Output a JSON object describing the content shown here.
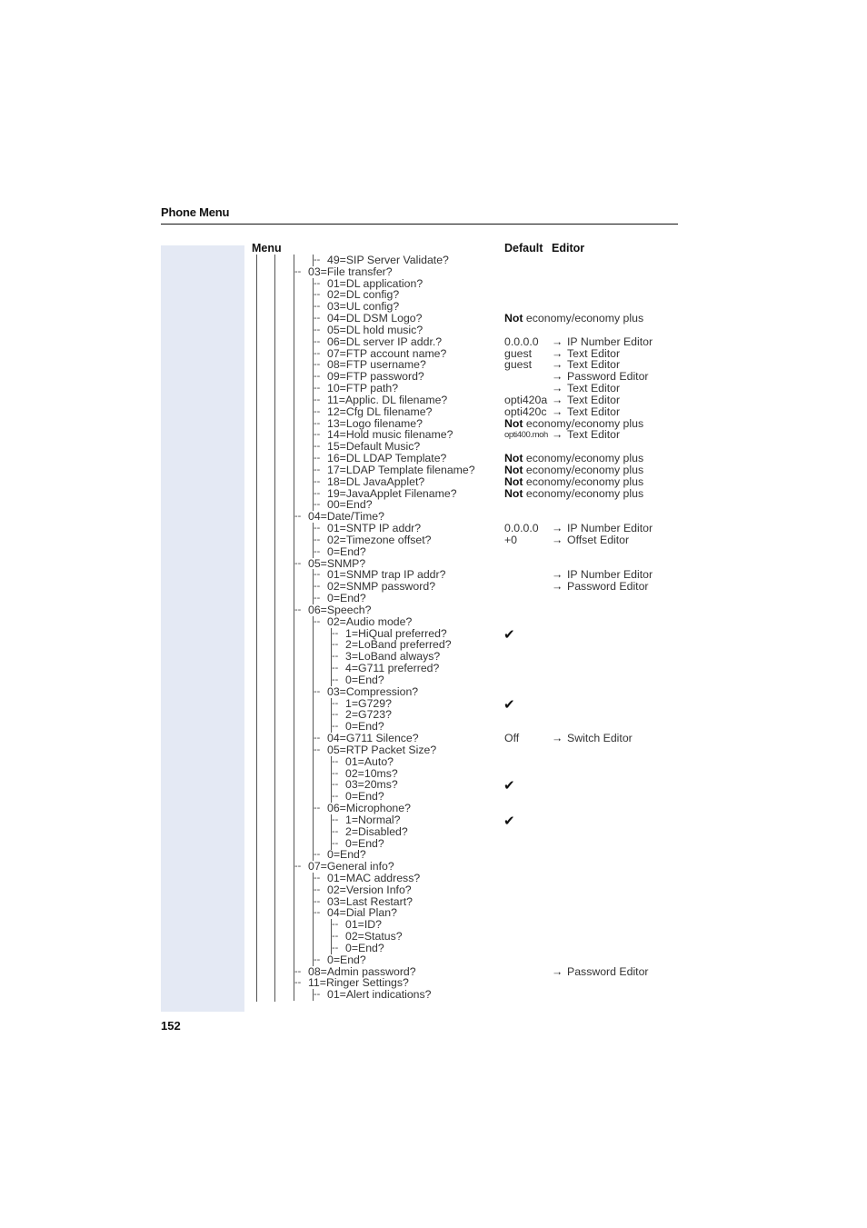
{
  "section_title": "Phone Menu",
  "page_number": "152",
  "columns": {
    "menu": "Menu",
    "default": "Default",
    "editor": "Editor"
  },
  "arrow_icon": "→",
  "check_icon": "✔",
  "rows": [
    {
      "level": 3,
      "text": "|-- 49=SIP Server Validate?",
      "label": "49=SIP Server Validate?"
    },
    {
      "level": 2,
      "label": "03=File transfer?"
    },
    {
      "level": 3,
      "label": "01=DL application?"
    },
    {
      "level": 3,
      "label": "02=DL config?"
    },
    {
      "level": 3,
      "label": "03=UL config?"
    },
    {
      "level": 3,
      "label": "04=DL DSM Logo?",
      "default_bold": "Not",
      "default": " economy/economy plus"
    },
    {
      "level": 3,
      "label": "05=DL hold music?"
    },
    {
      "level": 3,
      "label": "06=DL server IP addr.?",
      "default": "0.0.0.0",
      "editor": "IP Number Editor"
    },
    {
      "level": 3,
      "label": "07=FTP account name?",
      "default": "guest",
      "editor": "Text Editor"
    },
    {
      "level": 3,
      "label": "08=FTP username?",
      "default": "guest",
      "editor": "Text Editor"
    },
    {
      "level": 3,
      "label": "09=FTP password?",
      "editor": "Password Editor"
    },
    {
      "level": 3,
      "label": "10=FTP path?",
      "editor": "Text Editor"
    },
    {
      "level": 3,
      "label": "11=Applic. DL filename?",
      "default": "opti420a",
      "editor": "Text Editor"
    },
    {
      "level": 3,
      "label": "12=Cfg DL filename?",
      "default": "opti420c",
      "editor": "Text Editor"
    },
    {
      "level": 3,
      "label": "13=Logo filename?",
      "default_bold": "Not",
      "default": " economy/economy plus"
    },
    {
      "level": 3,
      "label": "14=Hold music filename?",
      "default": "opti400.moh",
      "default_small": true,
      "editor": "Text Editor"
    },
    {
      "level": 3,
      "label": "15=Default Music?"
    },
    {
      "level": 3,
      "label": "16=DL LDAP Template?",
      "default_bold": "Not",
      "default": " economy/economy plus"
    },
    {
      "level": 3,
      "label": "17=LDAP Template filename?",
      "default_bold": "Not",
      "default": " economy/economy plus"
    },
    {
      "level": 3,
      "label": "18=DL JavaApplet?",
      "default_bold": "Not",
      "default": " economy/economy plus"
    },
    {
      "level": 3,
      "label": "19=JavaApplet Filename?",
      "default_bold": "Not",
      "default": " economy/economy plus"
    },
    {
      "level": 3,
      "label": "00=End?"
    },
    {
      "level": 2,
      "label": "04=Date/Time?"
    },
    {
      "level": 3,
      "label": "01=SNTP IP addr?",
      "default": "0.0.0.0",
      "editor": "IP Number Editor"
    },
    {
      "level": 3,
      "label": "02=Timezone offset?",
      "default": "+0",
      "editor": "Offset Editor"
    },
    {
      "level": 3,
      "label": "0=End?"
    },
    {
      "level": 2,
      "label": "05=SNMP?"
    },
    {
      "level": 3,
      "label": "01=SNMP trap IP addr?",
      "editor": "IP Number Editor"
    },
    {
      "level": 3,
      "label": "02=SNMP password?",
      "editor": "Password Editor"
    },
    {
      "level": 3,
      "label": "0=End?"
    },
    {
      "level": 2,
      "label": "06=Speech?"
    },
    {
      "level": 3,
      "label": "02=Audio mode?"
    },
    {
      "level": 4,
      "label": "1=HiQual preferred?",
      "checked": true
    },
    {
      "level": 4,
      "label": "2=LoBand preferred?"
    },
    {
      "level": 4,
      "label": "3=LoBand always?"
    },
    {
      "level": 4,
      "label": "4=G711 preferred?"
    },
    {
      "level": 4,
      "label": "0=End?"
    },
    {
      "level": 3,
      "label": "03=Compression?"
    },
    {
      "level": 4,
      "label": "1=G729?",
      "checked": true
    },
    {
      "level": 4,
      "label": "2=G723?"
    },
    {
      "level": 4,
      "label": "0=End?"
    },
    {
      "level": 3,
      "label": "04=G711 Silence?",
      "default": "Off",
      "editor": "Switch Editor"
    },
    {
      "level": 3,
      "label": "05=RTP Packet Size?"
    },
    {
      "level": 4,
      "label": "01=Auto?"
    },
    {
      "level": 4,
      "label": "02=10ms?"
    },
    {
      "level": 4,
      "label": "03=20ms?",
      "checked": true
    },
    {
      "level": 4,
      "label": "0=End?"
    },
    {
      "level": 3,
      "label": "06=Microphone?"
    },
    {
      "level": 4,
      "label": "1=Normal?",
      "checked": true
    },
    {
      "level": 4,
      "label": "2=Disabled?"
    },
    {
      "level": 4,
      "label": "0=End?"
    },
    {
      "level": 3,
      "label": "0=End?"
    },
    {
      "level": 2,
      "label": "07=General info?"
    },
    {
      "level": 3,
      "label": "01=MAC address?"
    },
    {
      "level": 3,
      "label": "02=Version Info?"
    },
    {
      "level": 3,
      "label": "03=Last Restart?"
    },
    {
      "level": 3,
      "label": "04=Dial Plan?"
    },
    {
      "level": 4,
      "label": "01=ID?"
    },
    {
      "level": 4,
      "label": "02=Status?"
    },
    {
      "level": 4,
      "label": "0=End?"
    },
    {
      "level": 3,
      "label": "0=End?"
    },
    {
      "level": 2,
      "label": "08=Admin password?",
      "editor": "Password Editor"
    },
    {
      "level": 2,
      "label": "11=Ringer Settings?"
    },
    {
      "level": 3,
      "label": "01=Alert indications?"
    }
  ]
}
